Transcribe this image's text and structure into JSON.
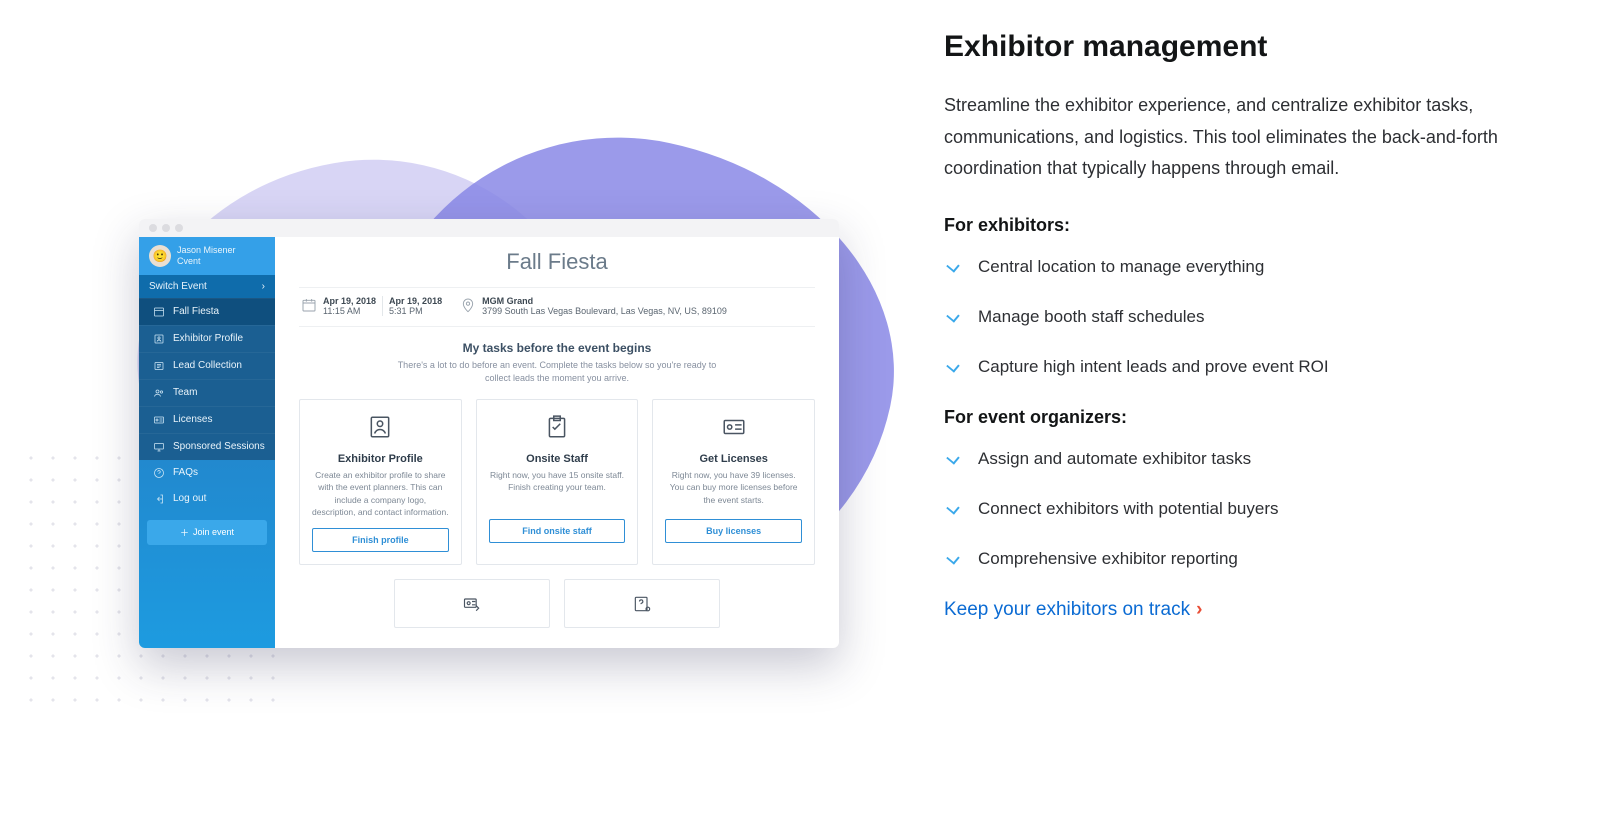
{
  "marketing": {
    "heading": "Exhibitor management",
    "lead": "Streamline the exhibitor experience, and centralize exhibitor tasks, communications, and logistics. This tool eliminates the back-and-forth coordination that typically happens through email.",
    "exhibitors_heading": "For exhibitors:",
    "exhibitors_items": [
      "Central location to manage everything",
      "Manage booth staff schedules",
      "Capture high intent leads and prove event ROI"
    ],
    "organizers_heading": "For event organizers:",
    "organizers_items": [
      "Assign and automate exhibitor tasks",
      "Connect exhibitors with potential buyers",
      "Comprehensive exhibitor reporting"
    ],
    "cta_label": "Keep your exhibitors on track"
  },
  "app": {
    "user": {
      "name": "Jason Misener",
      "org": "Cvent"
    },
    "switch_label": "Switch Event",
    "nav": [
      {
        "label": "Fall Fiesta"
      },
      {
        "label": "Exhibitor Profile"
      },
      {
        "label": "Lead Collection"
      },
      {
        "label": "Team"
      },
      {
        "label": "Licenses"
      },
      {
        "label": "Sponsored Sessions"
      }
    ],
    "secondary": [
      {
        "label": "FAQs"
      },
      {
        "label": "Log out"
      }
    ],
    "join_label": "Join event",
    "event": {
      "title": "Fall Fiesta",
      "start_date": "Apr 19, 2018",
      "start_time": "11:15 AM",
      "end_date": "Apr 19, 2018",
      "end_time": "5:31 PM",
      "venue": "MGM Grand",
      "address": "3799 South Las Vegas Boulevard, Las Vegas, NV, US, 89109"
    },
    "tasks": {
      "heading": "My tasks before the event begins",
      "sub": "There's a lot to do before an event. Complete the tasks below so you're ready to collect leads the moment you arrive.",
      "cards": [
        {
          "title": "Exhibitor Profile",
          "desc": "Create an exhibitor profile to share with the event planners. This can include a company logo, description, and contact information.",
          "btn": "Finish profile"
        },
        {
          "title": "Onsite Staff",
          "desc": "Right now, you have 15 onsite staff. Finish creating your team.",
          "btn": "Find onsite staff"
        },
        {
          "title": "Get Licenses",
          "desc": "Right now, you have 39 licenses. You can buy more licenses before the event starts.",
          "btn": "Buy licenses"
        }
      ]
    }
  }
}
